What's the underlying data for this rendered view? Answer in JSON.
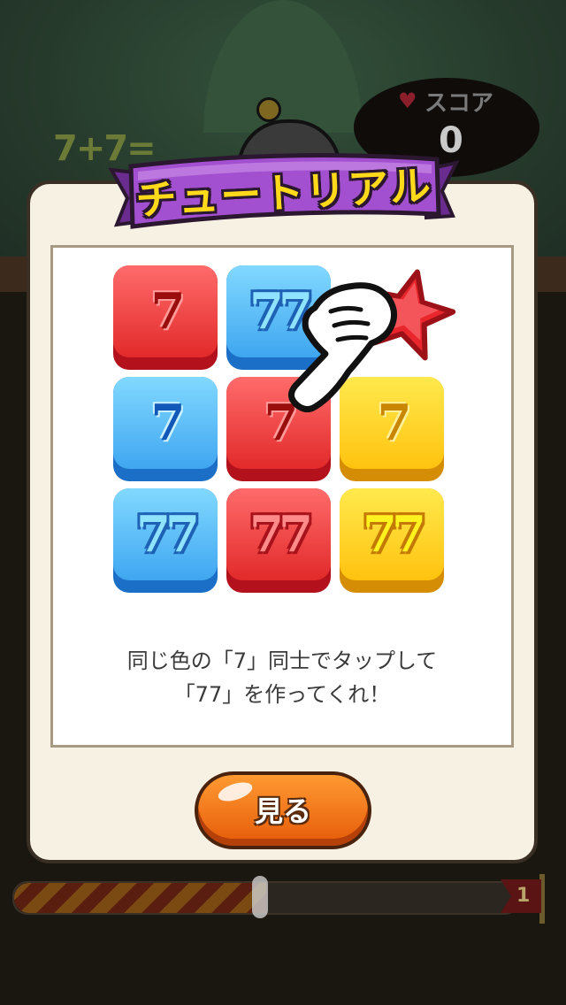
{
  "hud": {
    "formula": "7+7=",
    "score_label": "スコア",
    "score_value": "0",
    "level": "1",
    "progress": 0.5
  },
  "dialog": {
    "title": "チュートリアル",
    "tiles": [
      {
        "glyph": "7",
        "color": "red"
      },
      {
        "glyph": "77",
        "color": "blue"
      },
      {
        "glyph": "",
        "color": "star-red"
      },
      {
        "glyph": "7",
        "color": "blue"
      },
      {
        "glyph": "7",
        "color": "red"
      },
      {
        "glyph": "7",
        "color": "yellow"
      },
      {
        "glyph": "77",
        "color": "blue"
      },
      {
        "glyph": "77",
        "color": "red"
      },
      {
        "glyph": "77",
        "color": "yellow"
      }
    ],
    "instruction_line1": "同じ色の「7」同士でタップして",
    "instruction_line2": "「77」を作ってくれ！",
    "button_label": "見る"
  },
  "colors": {
    "dialog_bg": "#f6f1e3",
    "ribbon": "#a24fd0",
    "title_text": "#ffd91a",
    "button": "#f07a1a"
  }
}
